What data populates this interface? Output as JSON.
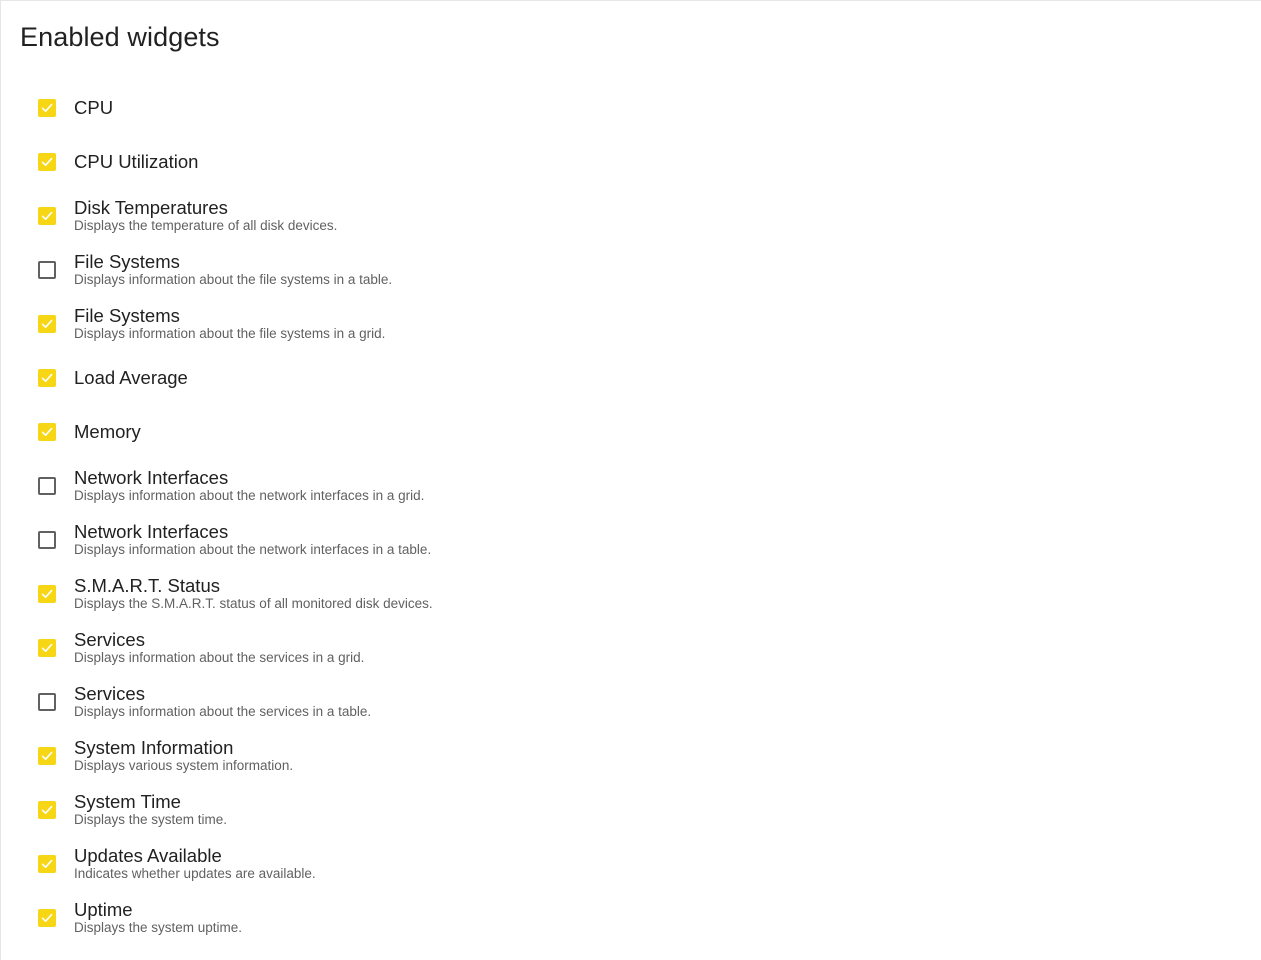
{
  "page": {
    "title": "Enabled widgets"
  },
  "colors": {
    "checkbox_checked": "#f7d715",
    "checkbox_border": "#616161",
    "title_text": "#212121",
    "description_text": "#616161"
  },
  "widgets": [
    {
      "title": "CPU",
      "description": "",
      "checked": true
    },
    {
      "title": "CPU Utilization",
      "description": "",
      "checked": true
    },
    {
      "title": "Disk Temperatures",
      "description": "Displays the temperature of all disk devices.",
      "checked": true
    },
    {
      "title": "File Systems",
      "description": "Displays information about the file systems in a table.",
      "checked": false
    },
    {
      "title": "File Systems",
      "description": "Displays information about the file systems in a grid.",
      "checked": true
    },
    {
      "title": "Load Average",
      "description": "",
      "checked": true
    },
    {
      "title": "Memory",
      "description": "",
      "checked": true
    },
    {
      "title": "Network Interfaces",
      "description": "Displays information about the network interfaces in a grid.",
      "checked": false
    },
    {
      "title": "Network Interfaces",
      "description": "Displays information about the network interfaces in a table.",
      "checked": false
    },
    {
      "title": "S.M.A.R.T. Status",
      "description": "Displays the S.M.A.R.T. status of all monitored disk devices.",
      "checked": true
    },
    {
      "title": "Services",
      "description": "Displays information about the services in a grid.",
      "checked": true
    },
    {
      "title": "Services",
      "description": "Displays information about the services in a table.",
      "checked": false
    },
    {
      "title": "System Information",
      "description": "Displays various system information.",
      "checked": true
    },
    {
      "title": "System Time",
      "description": "Displays the system time.",
      "checked": true
    },
    {
      "title": "Updates Available",
      "description": "Indicates whether updates are available.",
      "checked": true
    },
    {
      "title": "Uptime",
      "description": "Displays the system uptime.",
      "checked": true
    }
  ]
}
